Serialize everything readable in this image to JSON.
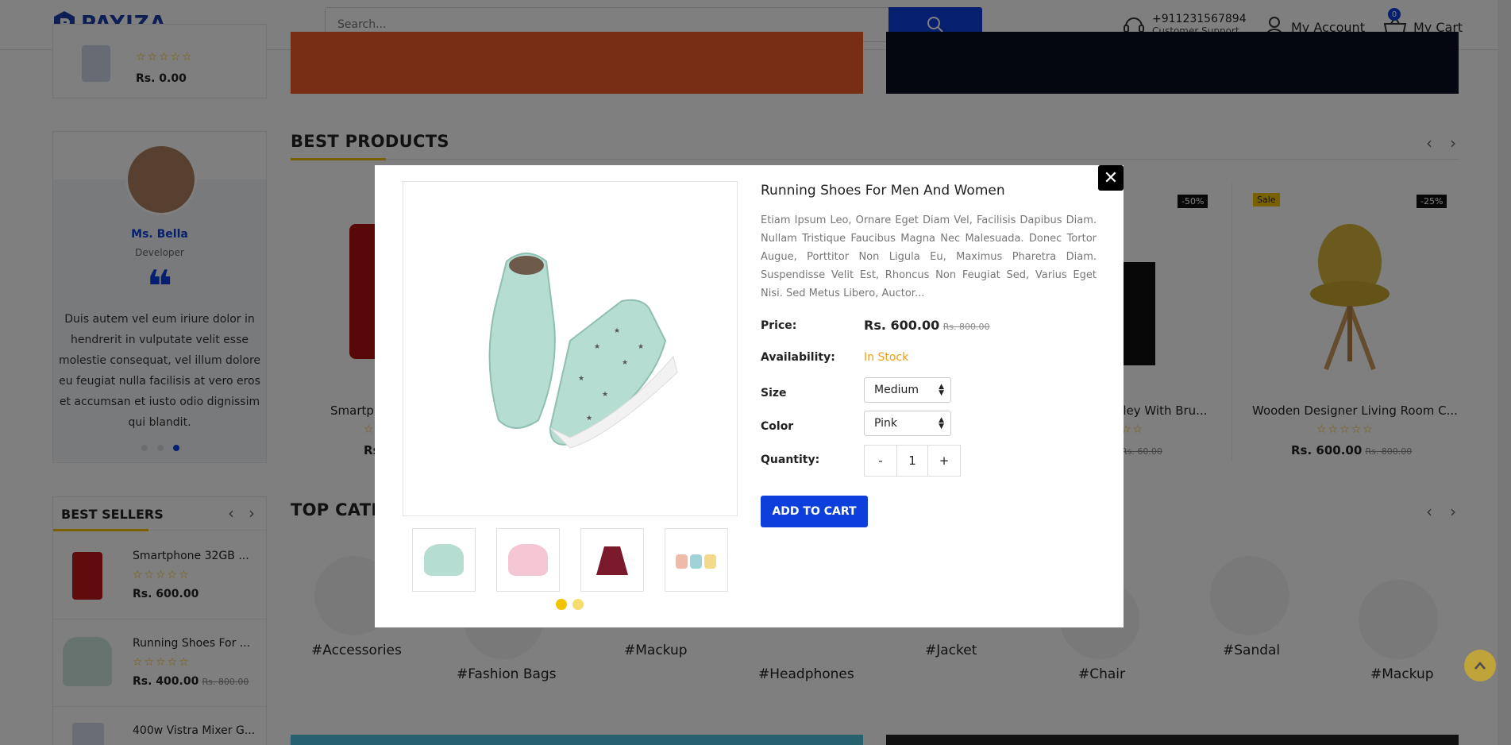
{
  "brand": {
    "name": "PAYIZA",
    "dot": "."
  },
  "search": {
    "placeholder": "Search..."
  },
  "header": {
    "phone": "+911231567894",
    "support": "Customer Support",
    "account": "My Account",
    "cart": "My Cart",
    "cart_count": "0"
  },
  "sidebar_top_product": {
    "price": "Rs. 0.00"
  },
  "testimonial": {
    "name": "Ms. Bella",
    "role": "Developer",
    "quote": "Duis autem vel eum iriure dolor in hendrerit in vulputate velit esse molestie consequat, vel illum dolore eu feugiat nulla facilisis at vero eros et accumsan et iusto odio dignissim qui blandit."
  },
  "best_products": {
    "title": "BEST PRODUCTS",
    "items": [
      {
        "name": "Smartp",
        "price": "Rs."
      },
      {
        "name": "alley With Bru...",
        "old_price": "Rs. 60.00",
        "badge": "-50%"
      },
      {
        "name": "Wooden Designer Living Room C...",
        "price": "Rs. 600.00",
        "old_price": "Rs. 800.00",
        "badge_sale": "Sale",
        "badge": "-25%"
      }
    ]
  },
  "best_sellers": {
    "title": "BEST SELLERS",
    "items": [
      {
        "name": "Smartphone 32GB ...",
        "price": "Rs. 600.00",
        "old_price": ""
      },
      {
        "name": "Running Shoes For ...",
        "price": "Rs. 400.00",
        "old_price": "Rs. 800.00"
      },
      {
        "name": "400w Vistra Mixer G...",
        "price": "",
        "old_price": ""
      }
    ]
  },
  "top_categories": {
    "title": "TOP CATE",
    "items": [
      "#Accessories",
      "#Fashion Bags",
      "#Mackup",
      "#Headphones",
      "#Jacket",
      "#Chair",
      "#Sandal",
      "#Mackup"
    ]
  },
  "modal": {
    "title": "Running Shoes For Men And Women",
    "description": "Etiam Ipsum Leo, Ornare Eget Diam Vel, Facilisis Dapibus Diam. Nullam Tristique Faucibus Magna Nec Malesuada. Donec Tortor Augue, Porttitor Non Ligula Eu, Maximus Pharetra Diam. Suspendisse Velit Est, Rhoncus Non Feugiat Sed, Varius Eget Nisi. Sed Metus Libero, Auctor...",
    "price_label": "Price:",
    "price": "Rs. 600.00",
    "old_price": "Rs. 800.00",
    "availability_label": "Availability:",
    "availability": "In Stock",
    "size_label": "Size",
    "size_value": "Medium",
    "color_label": "Color",
    "color_value": "Pink",
    "quantity_label": "Quantity:",
    "quantity": "1",
    "minus": "-",
    "plus": "+",
    "add_to_cart": "ADD TO CART",
    "close": "✕"
  },
  "colors": {
    "primary": "#0d3fdc",
    "accent": "#f4c300",
    "stock": "#f39c12"
  }
}
